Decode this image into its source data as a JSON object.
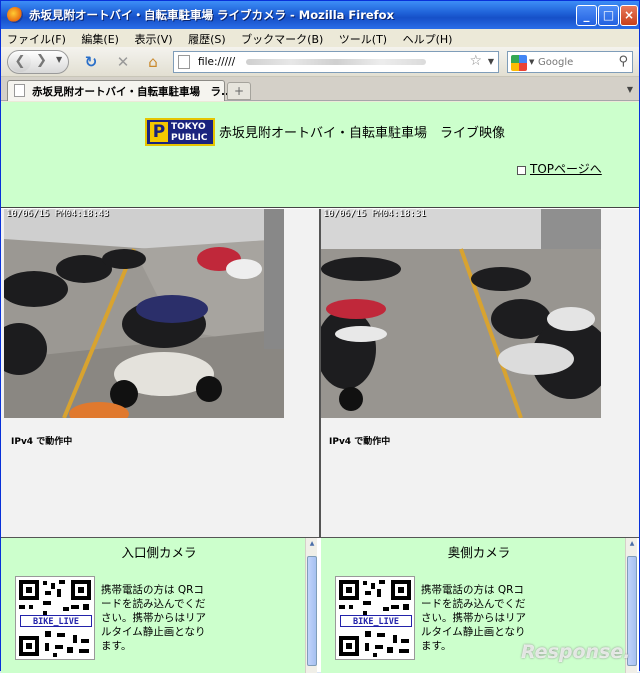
{
  "window": {
    "title": "赤坂見附オートバイ・自転車駐車場 ライブカメラ - Mozilla Firefox",
    "minimize": "_",
    "maximize": "□",
    "close": "×"
  },
  "menu": {
    "items": [
      {
        "label": "ファイル(F)"
      },
      {
        "label": "編集(E)"
      },
      {
        "label": "表示(V)"
      },
      {
        "label": "履歴(S)"
      },
      {
        "label": "ブックマーク(B)"
      },
      {
        "label": "ツール(T)"
      },
      {
        "label": "ヘルプ(H)"
      }
    ]
  },
  "nav": {
    "url": "file://///",
    "search_placeholder": "Google"
  },
  "tabs": [
    {
      "label": "赤坂見附オートバイ・自転車駐車場　ラ..."
    }
  ],
  "page": {
    "header": {
      "logo_line1": "TOKYO",
      "logo_line2": "PUBLIC",
      "logo_letter": "P",
      "title": "赤坂見附オートバイ・自転車駐車場　ライブ映像",
      "top_link": "TOPページへ"
    },
    "cameras": [
      {
        "timestamp": "10/06/15 PM04:18:43",
        "status": "IPv4 で動作中"
      },
      {
        "timestamp": "10/06/15 PM04:18:31",
        "status": "IPv4 で動作中"
      }
    ],
    "panels": [
      {
        "title": "入口側カメラ",
        "qr_label": "BIKE_LIVE",
        "note": "携帯電話の方は QRコードを読み込んでください。携帯からはリアルタイム静止画となります。"
      },
      {
        "title": "奥側カメラ",
        "qr_label": "BIKE_LIVE",
        "note": "携帯電話の方は QRコードを読み込んでください。携帯からはリアルタイム静止画となります。"
      }
    ]
  },
  "watermark": "Response."
}
